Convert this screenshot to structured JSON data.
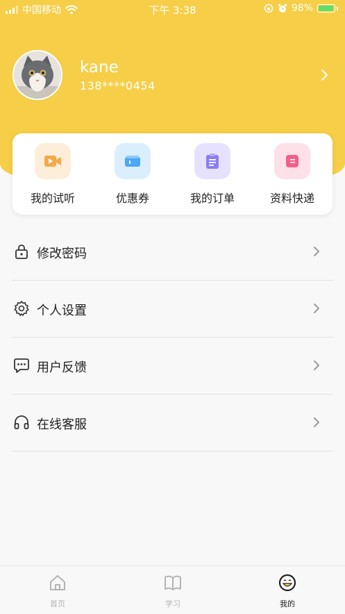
{
  "status_bar": {
    "carrier": "中国移动",
    "time": "下午 3:38",
    "battery": "98%",
    "battery_level": 0.98
  },
  "profile": {
    "name": "kane",
    "phone": "138****0454"
  },
  "quick_actions": [
    {
      "label": "我的试听",
      "icon": "video-icon",
      "color": "#f5a94a"
    },
    {
      "label": "优惠券",
      "icon": "coupon-icon",
      "color": "#4aa8f5"
    },
    {
      "label": "我的订单",
      "icon": "order-icon",
      "color": "#8b7cf6"
    },
    {
      "label": "资料快递",
      "icon": "document-icon",
      "color": "#f2608a"
    }
  ],
  "menu": [
    {
      "label": "修改密码",
      "icon": "lock-icon"
    },
    {
      "label": "个人设置",
      "icon": "gear-icon"
    },
    {
      "label": "用户反馈",
      "icon": "chat-icon"
    },
    {
      "label": "在线客服",
      "icon": "headphones-icon"
    }
  ],
  "tabs": [
    {
      "label": "首页",
      "icon": "home-icon",
      "active": false
    },
    {
      "label": "学习",
      "icon": "book-icon",
      "active": false
    },
    {
      "label": "我的",
      "icon": "profile-face-icon",
      "active": true
    }
  ],
  "colors": {
    "brand_yellow": "#f6ce47",
    "background": "#f8f8f8"
  }
}
